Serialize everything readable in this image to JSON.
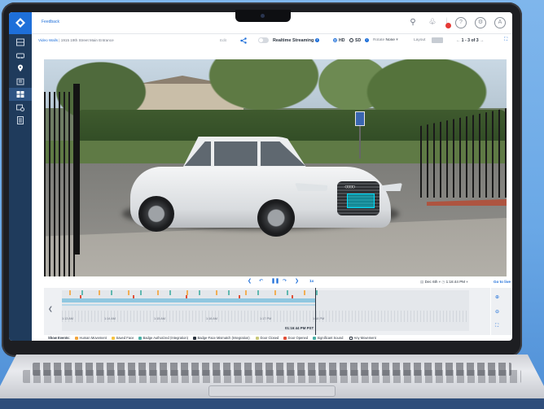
{
  "app": {
    "feedback_link": "Feedback",
    "brand_color": "#1e6fd9",
    "sidebar_color": "#1f3b5c"
  },
  "header": {
    "icons": [
      "search-icon",
      "notification-icon",
      "help-icon",
      "settings-icon",
      "account-icon"
    ],
    "account_initial": "A",
    "help_glyph": "?"
  },
  "sidebar": {
    "items": [
      {
        "icon": "dashboard-icon",
        "active": false
      },
      {
        "icon": "vehicle-icon",
        "active": false
      },
      {
        "icon": "location-pin-icon",
        "active": false
      },
      {
        "icon": "building-icon",
        "active": false
      },
      {
        "icon": "video-wall-icon",
        "active": true
      },
      {
        "icon": "camera-settings-icon",
        "active": false
      },
      {
        "icon": "report-icon",
        "active": false
      }
    ]
  },
  "toolbar": {
    "breadcrumb_root": "Video Walls",
    "breadcrumb_sep": "|",
    "breadcrumb_current": "1915 19th Street Main Entrance",
    "edit_label": "Edit",
    "stream_label": "Realtime Streaming",
    "hd_label": "HD",
    "sd_label": "SD",
    "quality_selected": "HD",
    "rotate_label": "Rotate",
    "rotate_value": "None",
    "layout_label": "Layout",
    "pager_text": "1 - 3 of 3"
  },
  "playback": {
    "speed_label": "1x",
    "date_value": "Dec 6th",
    "time_value": "1:16:44 PM",
    "go_live_label": "Go to live"
  },
  "timeline": {
    "playhead_time": "01:16:44 PM PST",
    "labels": [
      "1:13 AM",
      "1:14 AM",
      "1:15 AM",
      "1:16 AM",
      "1:17 PM",
      "1:18 PM"
    ]
  },
  "events": {
    "label": "Show Events:",
    "items": [
      {
        "label": "Human Movement",
        "color": "#f3a43b"
      },
      {
        "label": "Saved Face",
        "color": "#f6c343"
      },
      {
        "label": "Badge Authorized (Integration)",
        "color": "#4ab0a6"
      },
      {
        "label": "Badge-Face Mismatch (Integration)",
        "color": "#2b3440"
      },
      {
        "label": "Door Closed",
        "color": "#c9c87a"
      },
      {
        "label": "Door Opened",
        "color": "#e0503a"
      },
      {
        "label": "Significant Sound",
        "color": "#4ab0a6"
      },
      {
        "label": "Any Movement",
        "color": "#ffffff"
      }
    ]
  }
}
